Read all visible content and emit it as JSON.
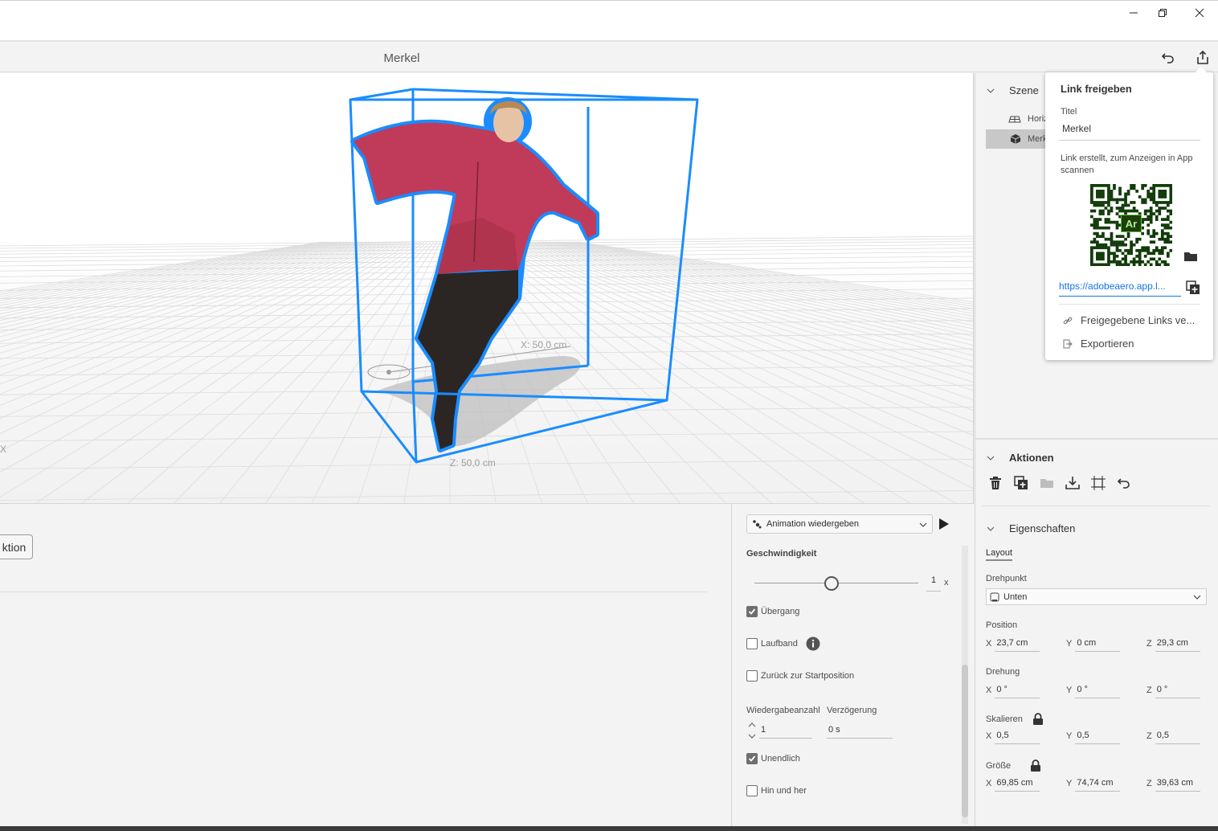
{
  "document": {
    "title": "Merkel"
  },
  "viewport": {
    "x_dimension": "X: 50,0 cm",
    "z_dimension": "Z: 50,0 cm",
    "axis_letter": "X"
  },
  "left_panel": {
    "button_label": "ktion"
  },
  "animation": {
    "action_select": "Animation wiedergeben",
    "speed_label": "Geschwindigkeit",
    "speed_value": "1",
    "speed_unit": "x",
    "speed_fraction": 0.47,
    "transition_label": "Übergang",
    "transition_checked": true,
    "treadmill_label": "Laufband",
    "treadmill_checked": false,
    "reset_label": "Zurück zur Startposition",
    "reset_checked": false,
    "repeat_label": "Wiedergabeanzahl",
    "repeat_value": "1",
    "delay_label": "Verzögerung",
    "delay_value": "0 s",
    "infinite_label": "Unendlich",
    "infinite_checked": true,
    "pingpong_label": "Hin und her",
    "pingpong_checked": false
  },
  "scene": {
    "title": "Szene",
    "items": [
      {
        "label": "Horiz",
        "icon": "horizontal-plane-icon",
        "selected": false
      },
      {
        "label": "Merk",
        "icon": "cube-icon",
        "selected": true
      }
    ]
  },
  "actions": {
    "title": "Aktionen"
  },
  "properties": {
    "title": "Eigenschaften",
    "tab": "Layout",
    "pivot_label": "Drehpunkt",
    "pivot_value": "Unten",
    "position_label": "Position",
    "position": {
      "x": "23,7 cm",
      "y": "0 cm",
      "z": "29,3 cm"
    },
    "rotation_label": "Drehung",
    "rotation": {
      "x": "0 °",
      "y": "0 °",
      "z": "0 °"
    },
    "scale_label": "Skalieren",
    "scale": {
      "x": "0,5",
      "y": "0,5",
      "z": "0,5"
    },
    "size_label": "Größe",
    "size": {
      "x": "69,85 cm",
      "y": "74,74 cm",
      "z": "39,63 cm"
    },
    "axis_x": "X",
    "axis_y": "Y",
    "axis_z": "Z"
  },
  "share_popover": {
    "title": "Link freigeben",
    "title_label": "Titel",
    "title_value": "Merkel",
    "info": "Link erstellt, zum Anzeigen in App scannen",
    "qr_logo": "Ar",
    "link": "https://adobeaero.app.l...",
    "manage_links": "Freigegebene Links ve...",
    "export": "Exportieren"
  },
  "colors": {
    "selection_blue": "#1a8cff",
    "link_blue": "#1473e6",
    "jacket": "#c03a5a"
  }
}
